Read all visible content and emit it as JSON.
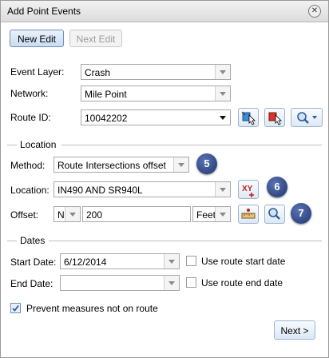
{
  "window": {
    "title": "Add Point Events"
  },
  "toolbar": {
    "new_edit": "New Edit",
    "next_edit": "Next Edit"
  },
  "fields": {
    "event_layer_label": "Event Layer:",
    "event_layer_value": "Crash",
    "network_label": "Network:",
    "network_value": "Mile Point",
    "route_id_label": "Route ID:",
    "route_id_value": "10042202"
  },
  "location": {
    "section_label": "Location",
    "method_label": "Method:",
    "method_value": "Route Intersections offset",
    "location_label": "Location:",
    "location_value": "IN490 AND SR940L",
    "offset_label": "Offset:",
    "offset_direction": "N",
    "offset_value": "200",
    "offset_unit": "Feet",
    "callouts": [
      "5",
      "6",
      "7"
    ]
  },
  "dates": {
    "section_label": "Dates",
    "start_label": "Start Date:",
    "start_value": "6/12/2014",
    "end_label": "End Date:",
    "end_value": "",
    "use_start": "Use route start date",
    "use_end": "Use route end date"
  },
  "options": {
    "prevent_measures": "Prevent measures not on route",
    "prevent_measures_checked": true
  },
  "footer": {
    "next": "Next >"
  },
  "colors": {
    "accent": "#1f3470",
    "button_border": "#9bb4cf"
  },
  "icons": [
    "close-icon",
    "select-route-icon",
    "clear-route-icon",
    "search-icon",
    "xy-location-icon",
    "measure-offset-icon",
    "zoom-icon",
    "checkmark-icon"
  ]
}
